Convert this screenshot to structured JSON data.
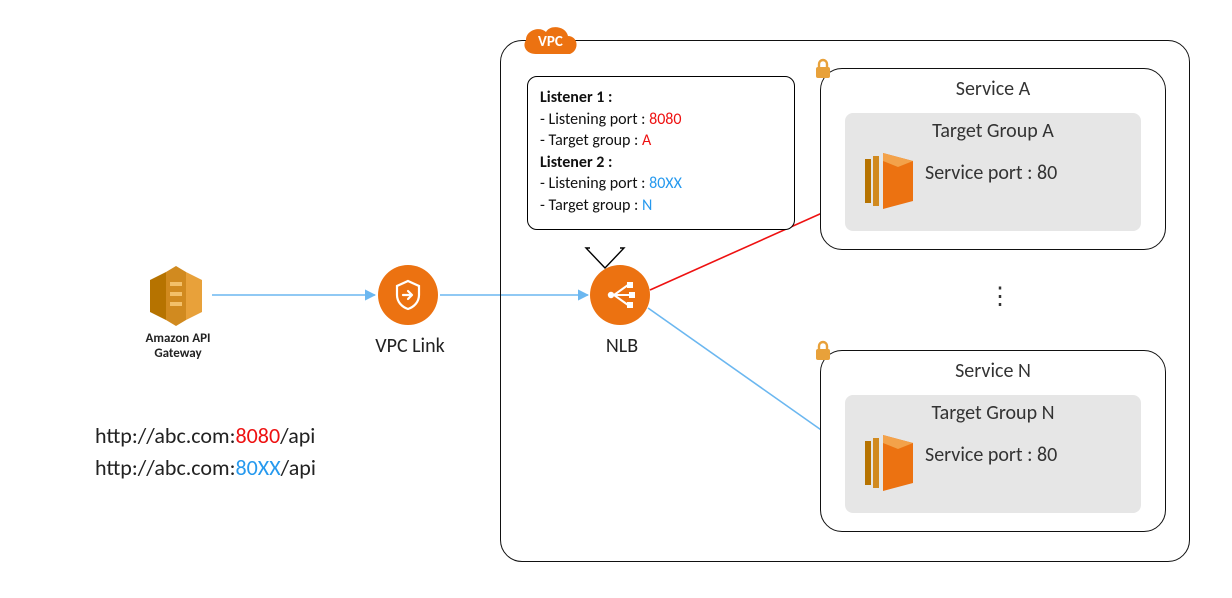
{
  "nodes": {
    "api_gateway": {
      "label": "Amazon API\nGateway"
    },
    "vpc_link": {
      "label": "VPC Link"
    },
    "nlb": {
      "label": "NLB"
    }
  },
  "vpc_badge": "VPC",
  "callout": {
    "listener1_title": "Listener 1 :",
    "l1_port_label": "Listening port : ",
    "l1_port": "8080",
    "l1_tg_label": "Target group : ",
    "l1_tg": "A",
    "listener2_title": "Listener 2 :",
    "l2_port_label": "Listening port : ",
    "l2_port": "80XX",
    "l2_tg_label": "Target group : ",
    "l2_tg": "N"
  },
  "services": {
    "a": {
      "subnet_title": "Service A",
      "tg_title": "Target Group A",
      "svc_port": "Service port : 80"
    },
    "n": {
      "subnet_title": "Service N",
      "tg_title": "Target Group N",
      "svc_port": "Service port : 80"
    }
  },
  "ellipsis": "⋮",
  "urls": {
    "u1_pre": "http://abc.com:",
    "u1_port": "8080",
    "u1_post": "/api",
    "u2_pre": "http://abc.com:",
    "u2_port": "80XX",
    "u2_post": "/api"
  },
  "colors": {
    "orange": "#ec7211",
    "red_arrow": "#e11",
    "blue_arrow": "#2699ee",
    "blue_light": "#6bb7f0"
  }
}
